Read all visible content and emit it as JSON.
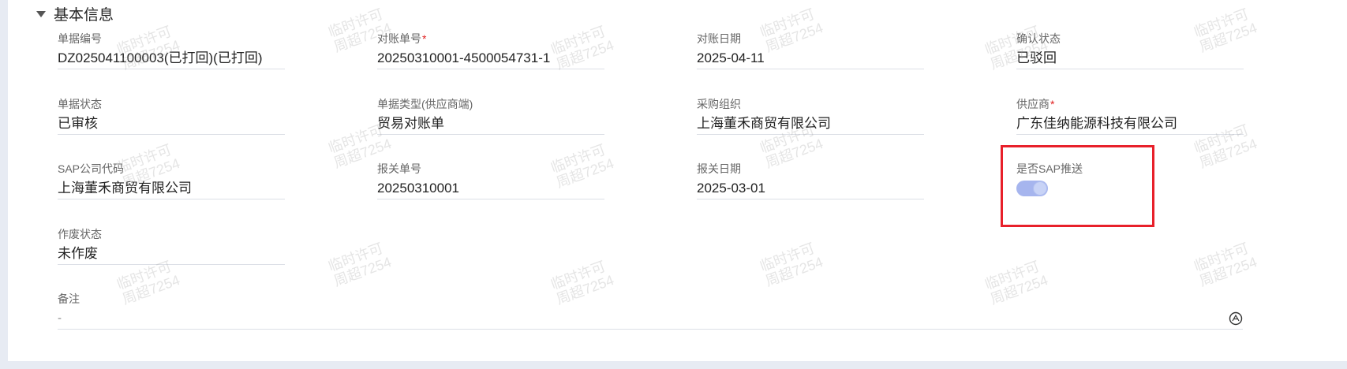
{
  "section": {
    "title": "基本信息"
  },
  "fields": [
    {
      "label": "单据编号",
      "value": "DZ025041100003(已打回)(已打回)"
    },
    {
      "label": "对账单号",
      "required": "*",
      "value": "20250310001-4500054731-1"
    },
    {
      "label": "对账日期",
      "value": "2025-04-11"
    },
    {
      "label": "确认状态",
      "value": "已驳回"
    },
    {
      "label": "单据状态",
      "value": "已审核"
    },
    {
      "label": "单据类型(供应商端)",
      "value": "贸易对账单"
    },
    {
      "label": "采购组织",
      "value": "上海董禾商贸有限公司"
    },
    {
      "label": "供应商",
      "required": "*",
      "value": "广东佳纳能源科技有限公司"
    },
    {
      "label": "SAP公司代码",
      "value": "上海董禾商贸有限公司"
    },
    {
      "label": "报关单号",
      "value": "20250310001"
    },
    {
      "label": "报关日期",
      "value": "2025-03-01"
    },
    {
      "label": "是否SAP推送",
      "toggle_on": true
    },
    {
      "label": "作废状态",
      "value": "未作废"
    }
  ],
  "remark": {
    "label": "备注",
    "value": "-"
  },
  "watermark": {
    "line1": "临时许可",
    "line2": "周超7254"
  },
  "colors": {
    "required": "#e02020",
    "highlight": "#e8202a",
    "toggle": "#a6b5ee"
  }
}
